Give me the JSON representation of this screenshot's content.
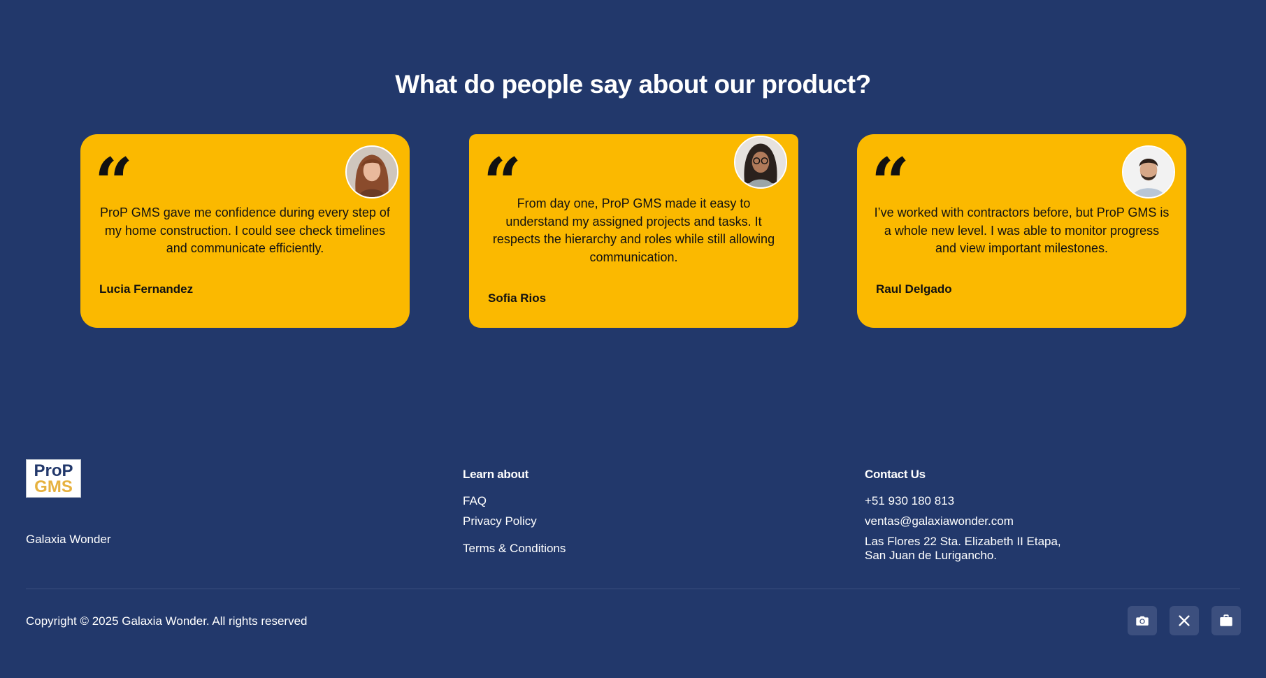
{
  "testimonials": {
    "title": "What do people say about our product?",
    "quote_glyph": "“",
    "items": [
      {
        "text": "ProP GMS gave me confidence during every step of my home construction. I could see check timelines and communicate efficiently.",
        "author": "Lucia Fernandez",
        "avatar_icon": "woman-avatar"
      },
      {
        "text": "From day one, ProP GMS made it easy to understand my assigned projects and tasks. It respects the hierarchy and roles while still allowing communication.",
        "author": "Sofia Rios",
        "avatar_icon": "woman-glasses-avatar"
      },
      {
        "text": "I’ve worked with contractors before, but ProP GMS is a whole new level. I was able to monitor progress and view important milestones.",
        "author": "Raul Delgado",
        "avatar_icon": "man-avatar"
      }
    ],
    "card_color": "#fbb900"
  },
  "footer": {
    "logo": {
      "line1": "ProP",
      "line2": "GMS"
    },
    "brand_name": "Galaxia Wonder",
    "learn": {
      "title": "Learn about",
      "links": [
        "FAQ",
        "Privacy Policy",
        "Terms & Conditions"
      ]
    },
    "contact": {
      "title": "Contact Us",
      "phone": "+51 930 180 813",
      "email": "ventas@galaxiawonder.com",
      "address_line1": "Las Flores 22 Sta. Elizabeth II Etapa,",
      "address_line2": "San Juan de Lurigancho."
    },
    "copyright": "Copyright © 2025 Galaxia Wonder. All rights reserved",
    "social": [
      "camera-icon",
      "x-icon",
      "briefcase-icon"
    ]
  },
  "colors": {
    "background": "#22386b",
    "accent": "#fbb900",
    "logo_blue": "#22386b",
    "logo_gold": "#e6b13e"
  }
}
